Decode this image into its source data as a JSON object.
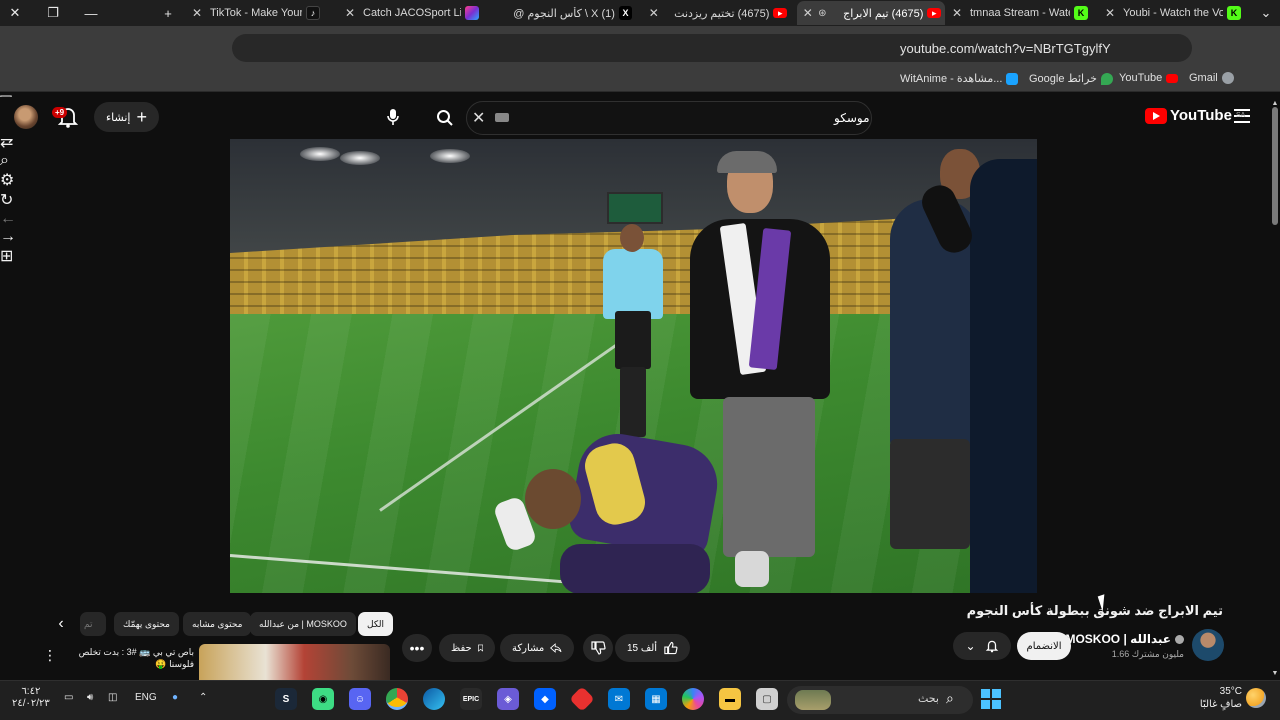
{
  "browser": {
    "tabs": [
      {
        "title": "TikTok - Make Your D",
        "favicon_color": "#111111",
        "favicon_glyph": "tiktok-icon",
        "active": false
      },
      {
        "title": "Catch JACOSport Live",
        "favicon_color": "#7b2fd1",
        "favicon_glyph": "jaco-icon",
        "active": false
      },
      {
        "title": "(1) X \\ كأس النجوم @",
        "favicon_color": "#000000",
        "favicon_glyph": "x-icon",
        "active": false
      },
      {
        "title": "(4675) تختيم ريزدنت",
        "favicon_color": "#ff0000",
        "favicon_glyph": "youtube-icon",
        "active": false
      },
      {
        "title": "(4675) تيم الابراج",
        "favicon_color": "#ff0000",
        "favicon_glyph": "youtube-icon",
        "active": true
      },
      {
        "title": "tmnaa Stream - Wate",
        "favicon_color": "#53fc18",
        "favicon_glyph": "kick-icon",
        "active": false
      },
      {
        "title": "Youbi - Watch the Vo",
        "favicon_color": "#53fc18",
        "favicon_glyph": "kick-icon",
        "active": false
      }
    ],
    "url": "youtube.com/watch?v=NBrTGTgylfY",
    "bookmarks": [
      {
        "label": "Gmail",
        "color": "#9aa0a6"
      },
      {
        "label": "YouTube",
        "color": "#ff0000"
      },
      {
        "label": "Google خرائط",
        "color": "#34a853"
      },
      {
        "label": "WitAnime - مشاهدة...",
        "color": "#1aa3ff"
      }
    ]
  },
  "youtube": {
    "logo_text": "YouTube",
    "logo_region": "SA",
    "search_value": "موسكو",
    "create_label": "إنشاء",
    "notification_count": "+9"
  },
  "video": {
    "title": "تيم الابراج ضد شونق ببطولة كأس النجوم",
    "channel_name": "MOSKOO | عبدالله",
    "subscribers": "1.66 مليون مشترك",
    "join_label": "الانضمام",
    "like_count": "15 ألف",
    "share_label": "مشاركة",
    "save_label": "حفظ"
  },
  "recommendations": {
    "chips": [
      "الكل",
      "من عبدالله | MOSKOO",
      "محتوى مشابه",
      "محتوى يهمّك",
      "تم"
    ],
    "first_title_line1": "باص تي بي 🚌 #3 : بدت تخلص",
    "first_title_line2": "فلوسنا 🤑"
  },
  "taskbar": {
    "search_label": "بحث",
    "language": "ENG",
    "temperature": "35°C",
    "weather_desc": "صافٍ غالبًا",
    "time": "٦:٤٢",
    "date": "٢٤/٠٢/٢٣"
  }
}
